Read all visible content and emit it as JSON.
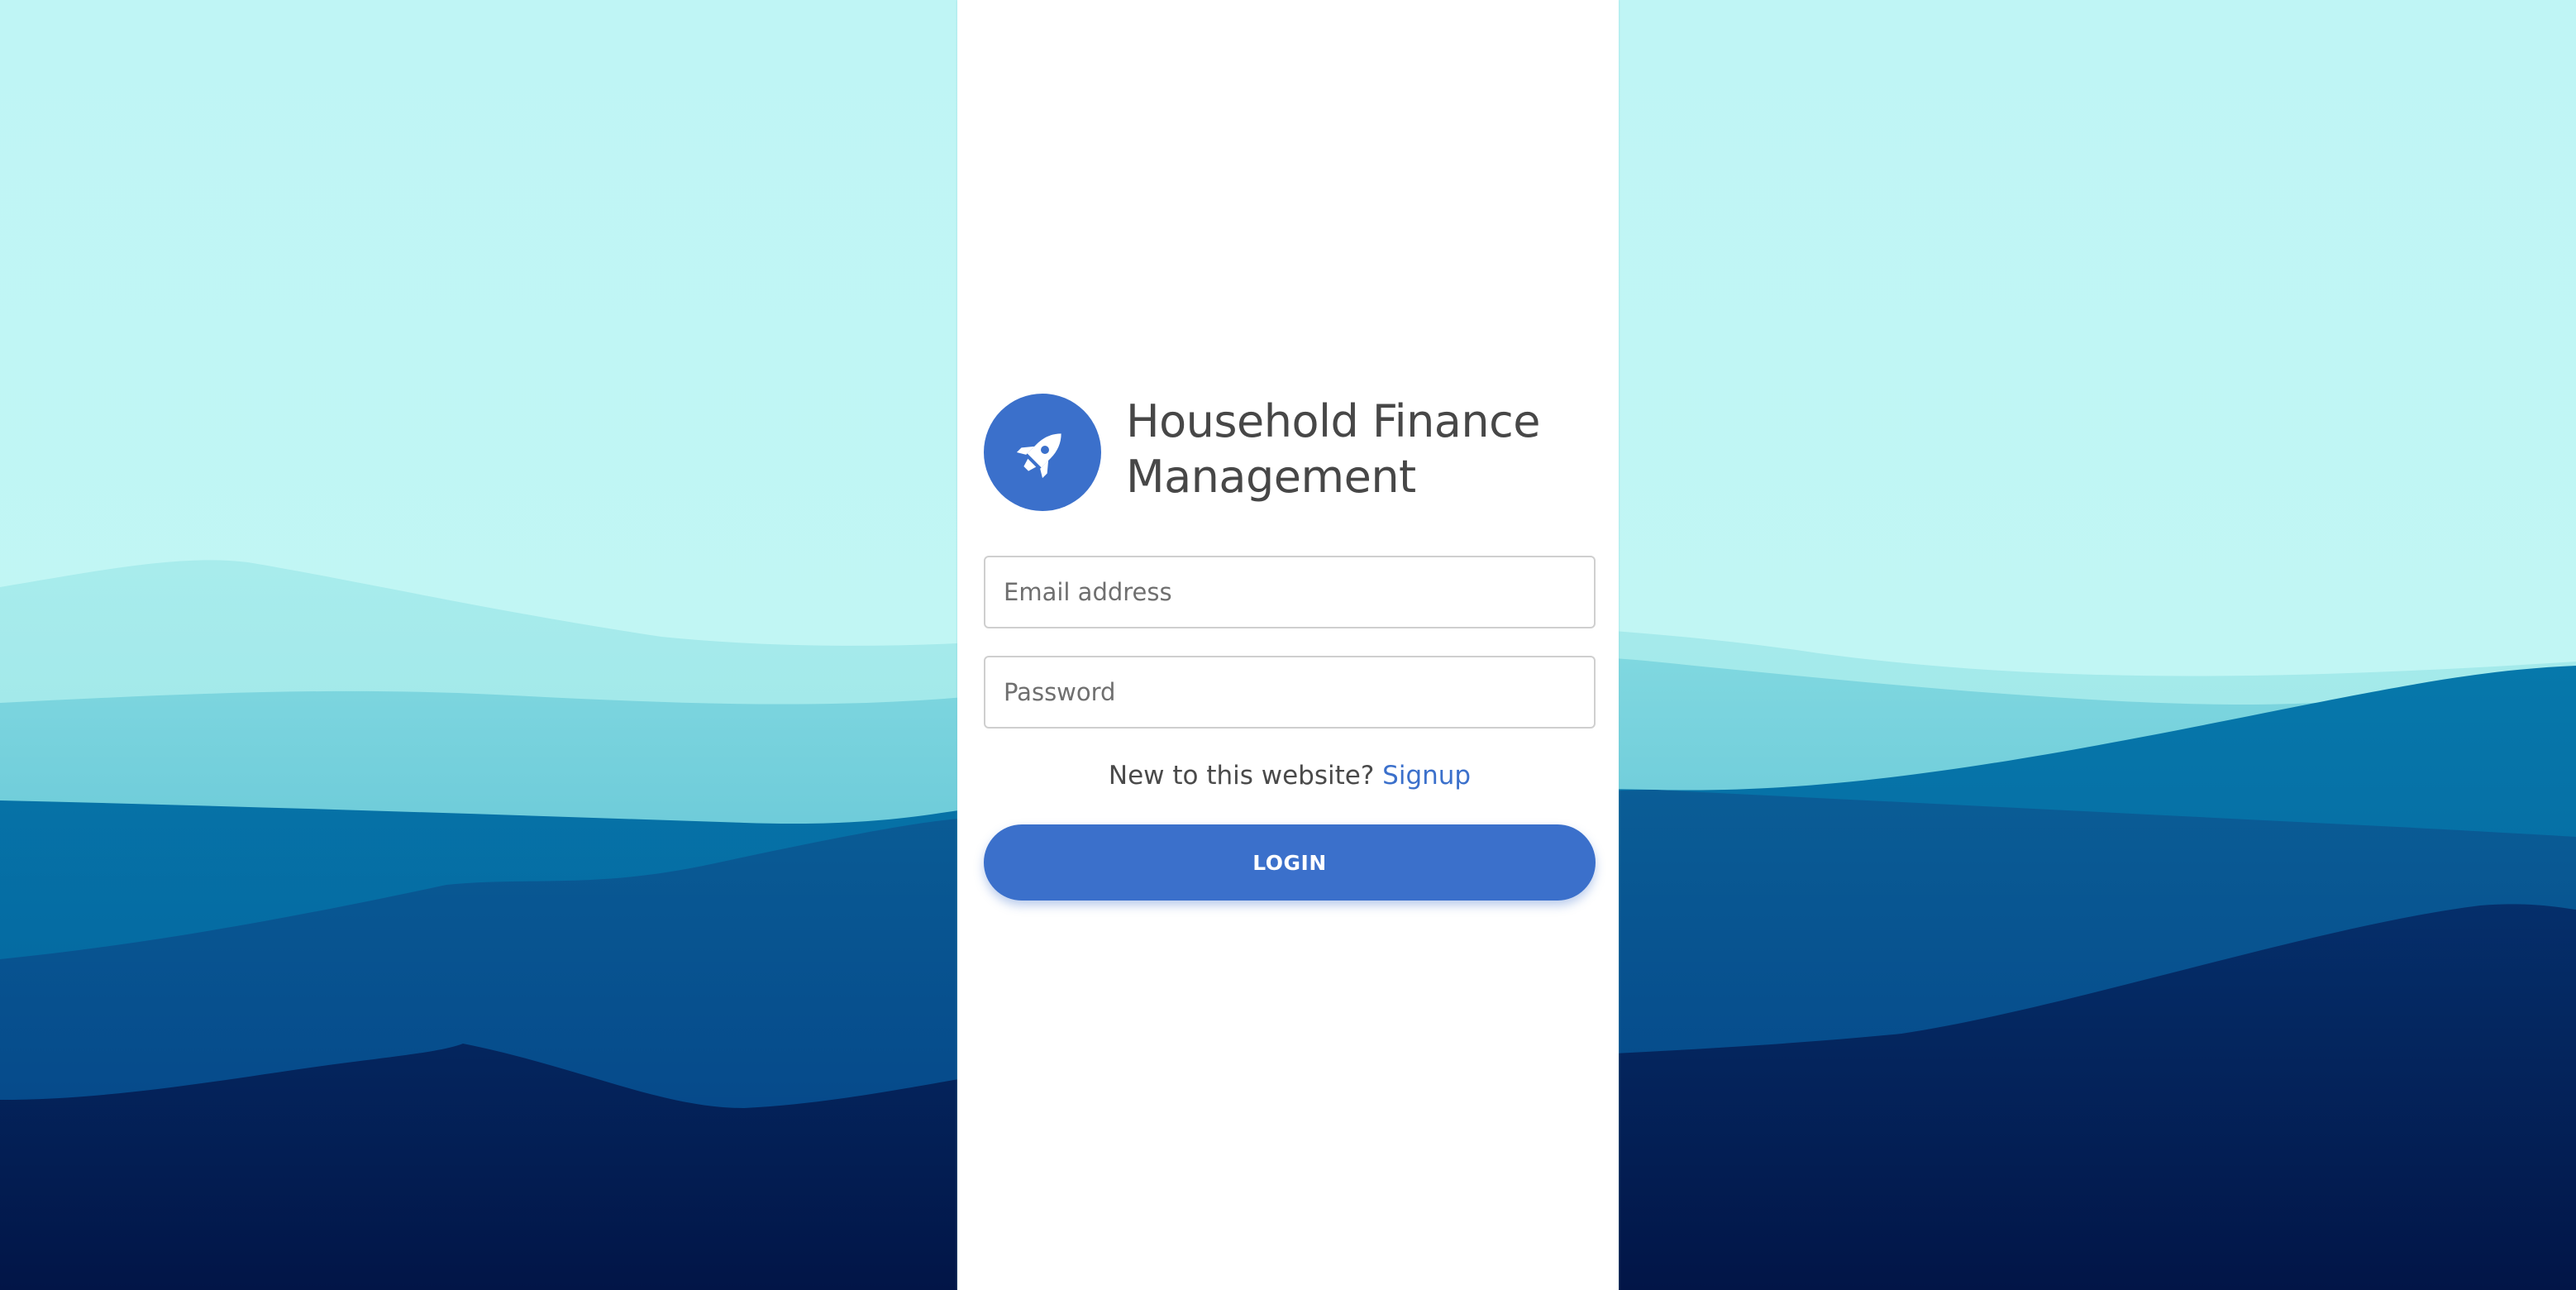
{
  "app": {
    "title": "Household Finance Management",
    "logo_icon": "rocket-icon"
  },
  "form": {
    "email_placeholder": "Email address",
    "password_placeholder": "Password",
    "email_value": "",
    "password_value": "",
    "signup_prompt": "New to this website?",
    "signup_link": "Signup",
    "login_label": "LOGIN"
  },
  "colors": {
    "accent": "#3b70cb",
    "sky": "#c0f6f6",
    "panel": "#ffffff",
    "mountain_dark": "#041c48",
    "mountain_mid": "#046fa5"
  }
}
